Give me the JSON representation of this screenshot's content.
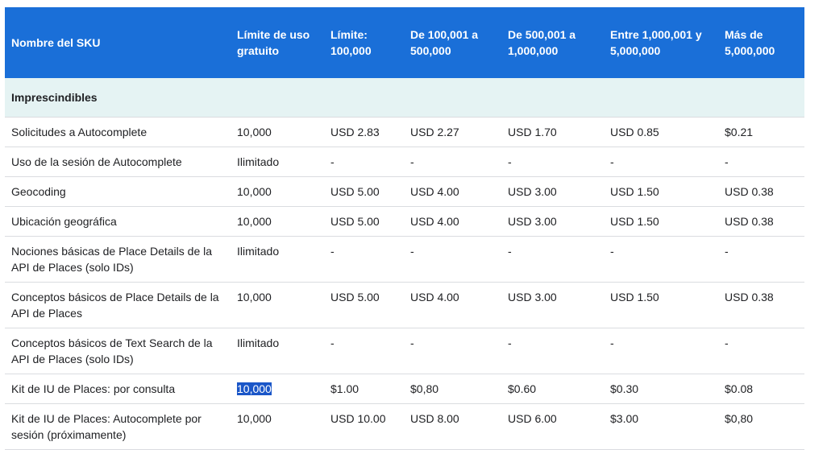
{
  "headers": [
    "Nombre del SKU",
    "Límite de uso gratuito",
    "Límite: 100,000",
    "De 100,001 a 500,000",
    "De 500,001 a 1,000,000",
    "Entre 1,000,001 y 5,000,000",
    "Más de 5,000,000"
  ],
  "section_title": "Imprescindibles",
  "rows": [
    [
      "Solicitudes a Autocomplete",
      "10,000",
      "USD 2.83",
      "USD 2.27",
      "USD 1.70",
      "USD 0.85",
      "$0.21"
    ],
    [
      "Uso de la sesión de Autocomplete",
      "Ilimitado",
      "-",
      "-",
      "-",
      "-",
      "-"
    ],
    [
      "Geocoding",
      "10,000",
      "USD 5.00",
      "USD 4.00",
      "USD 3.00",
      "USD 1.50",
      "USD 0.38"
    ],
    [
      "Ubicación geográfica",
      "10,000",
      "USD 5.00",
      "USD 4.00",
      "USD 3.00",
      "USD 1.50",
      "USD 0.38"
    ],
    [
      "Nociones básicas de Place Details de la API de Places (solo IDs)",
      "Ilimitado",
      "-",
      "-",
      "-",
      "-",
      "-"
    ],
    [
      "Conceptos básicos de Place Details de la API de Places",
      "10,000",
      "USD 5.00",
      "USD 4.00",
      "USD 3.00",
      "USD 1.50",
      "USD 0.38"
    ],
    [
      "Conceptos básicos de Text Search de la API de Places (solo IDs)",
      "Ilimitado",
      "-",
      "-",
      "-",
      "-",
      "-"
    ],
    [
      "Kit de IU de Places: por consulta",
      "10,000",
      "$1.00",
      "$0,80",
      "$0.60",
      "$0.30",
      "$0.08"
    ],
    [
      "Kit de IU de Places: Autocomplete por sesión (próximamente)",
      "10,000",
      "USD 10.00",
      "USD 8.00",
      "USD 6.00",
      "$3.00",
      "$0,80"
    ]
  ],
  "colors": {
    "header_bg": "#1a6fd8",
    "section_bg": "#e5f3f3",
    "selection_bg": "#1a56c8",
    "row_border": "#dadce0"
  }
}
